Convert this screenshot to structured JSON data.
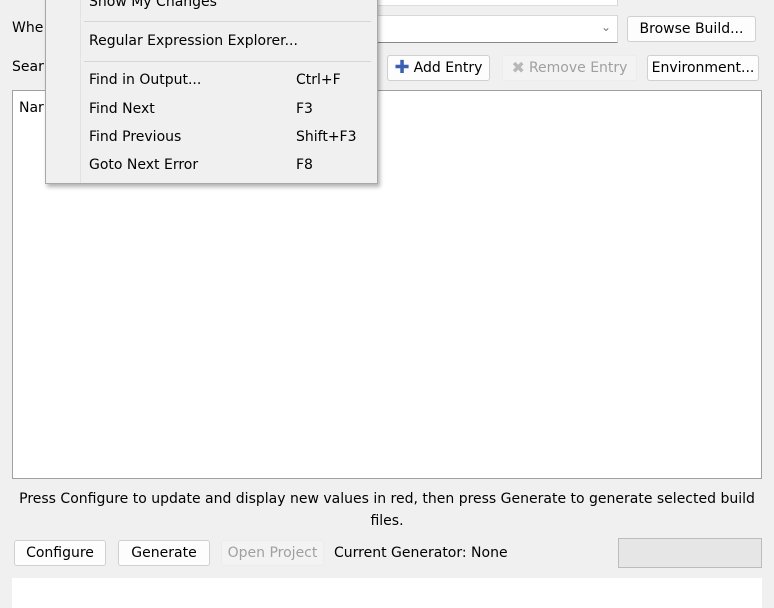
{
  "labels": {
    "where_build": "Whe",
    "search": "Sear",
    "tree_header": "Nar"
  },
  "buttons": {
    "browse_build": "Browse Build...",
    "add_entry": "Add Entry",
    "remove_entry": "Remove Entry",
    "environment": "Environment...",
    "configure": "Configure",
    "generate": "Generate",
    "open_project": "Open Project"
  },
  "status": {
    "message": "Press Configure to update and display new values in red, then press Generate to generate selected build files.",
    "current_generator": "Current Generator: None"
  },
  "menu": {
    "items": [
      {
        "label": "Show My Changes",
        "shortcut": ""
      },
      {
        "label": "Regular Expression Explorer...",
        "shortcut": ""
      },
      {
        "label": "Find in Output...",
        "shortcut": "Ctrl+F"
      },
      {
        "label": "Find Next",
        "shortcut": "F3"
      },
      {
        "label": "Find Previous",
        "shortcut": "Shift+F3"
      },
      {
        "label": "Goto Next Error",
        "shortcut": "F8"
      }
    ]
  },
  "colors": {
    "add_icon": "#3a5fb0",
    "remove_icon": "#b8b8b8"
  },
  "progress": 0
}
